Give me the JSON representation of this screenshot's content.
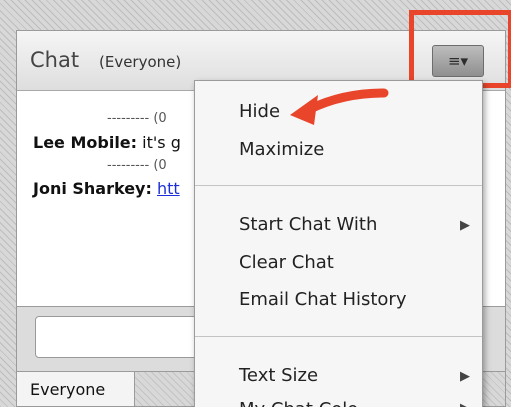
{
  "header": {
    "title": "Chat",
    "subtitle": "(Everyone)",
    "menu_button_glyph": "≡▾"
  },
  "messages": {
    "separator_1": "--------- (0",
    "separator_2": "--------- (0",
    "message_1": {
      "sender": "Lee Mobile:",
      "text": "it's g"
    },
    "message_2": {
      "sender": "Joni Sharkey:",
      "link": "htt"
    }
  },
  "footer": {
    "tab_label": "Everyone"
  },
  "menu": {
    "hide": "Hide",
    "maximize": "Maximize",
    "start_chat_with": "Start Chat With",
    "clear_chat": "Clear Chat",
    "email_chat_history": "Email Chat History",
    "text_size": "Text Size",
    "my_chat_color_partial": "My Chat Colo",
    "submenu_arrow": "▶"
  },
  "colors": {
    "highlight": "#e8452b",
    "link": "#1c2fd6"
  }
}
